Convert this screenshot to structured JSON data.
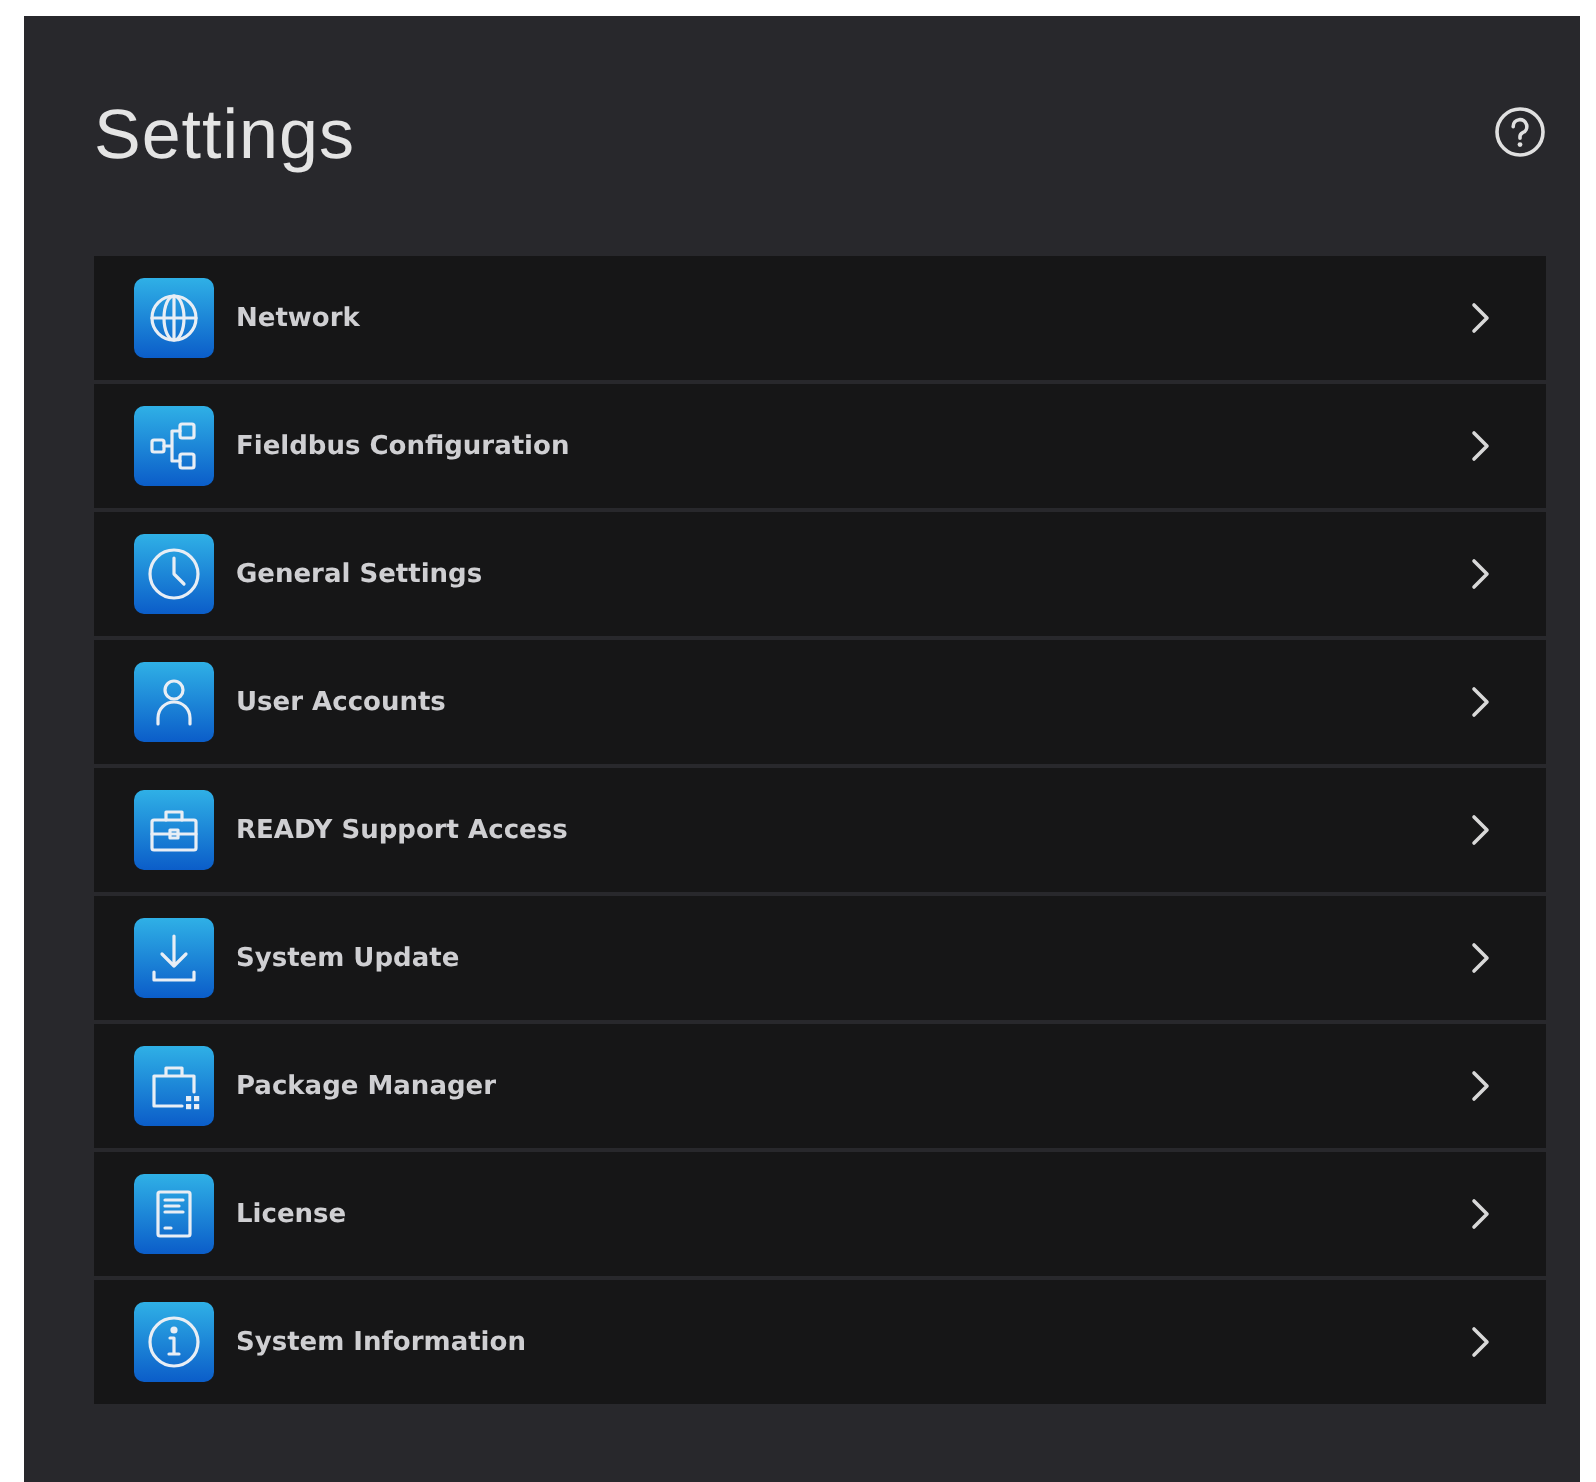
{
  "title": "Settings",
  "items": [
    {
      "label": "Network"
    },
    {
      "label": "Fieldbus Configuration"
    },
    {
      "label": "General Settings"
    },
    {
      "label": "User Accounts"
    },
    {
      "label": "READY Support Access"
    },
    {
      "label": "System Update"
    },
    {
      "label": "Package Manager"
    },
    {
      "label": "License"
    },
    {
      "label": "System Information"
    }
  ]
}
